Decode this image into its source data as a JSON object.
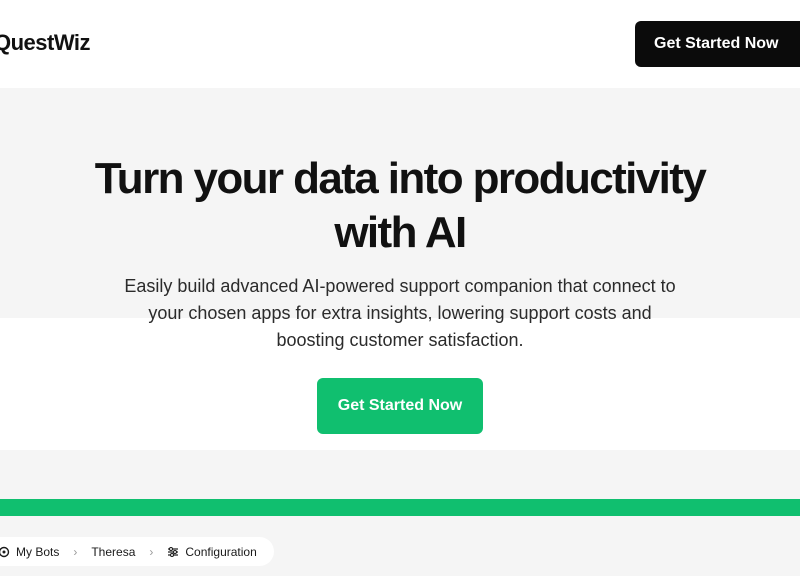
{
  "header": {
    "logo_text": "QuestWiz",
    "cta_label": "Get Started Now"
  },
  "hero": {
    "title_line1": "Turn your data into productivity",
    "title_line2": "with AI",
    "subtitle_line1": "Easily build advanced AI-powered support companion that connect to",
    "subtitle_line2": "your chosen apps for extra insights, lowering support costs and",
    "subtitle_line3": "boosting customer satisfaction.",
    "cta_label": "Get Started Now"
  },
  "preview": {
    "breadcrumb": [
      {
        "label": "My Bots",
        "icon": "bot-icon"
      },
      {
        "label": "Theresa"
      },
      {
        "label": "Configuration",
        "icon": "sliders-icon"
      }
    ]
  },
  "colors": {
    "accent": "#10bf6f",
    "dark": "#0b0b0b",
    "band": "#f5f5f5"
  }
}
